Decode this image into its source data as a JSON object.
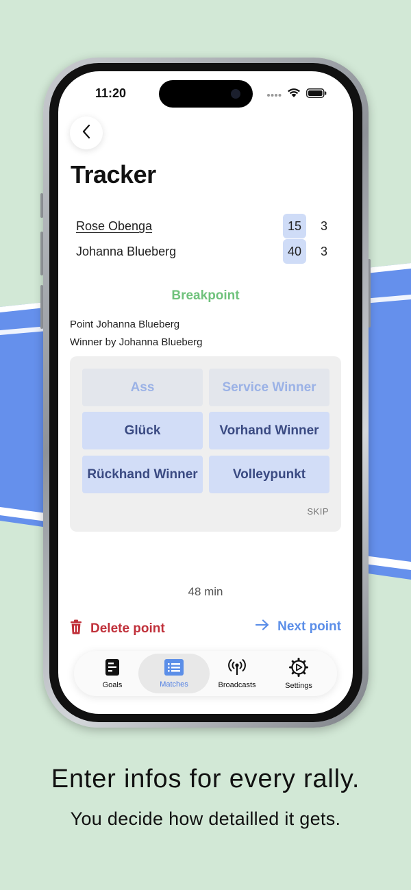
{
  "status_bar": {
    "time": "11:20"
  },
  "page": {
    "title": "Tracker"
  },
  "players": [
    {
      "name": "Rose Obenga",
      "points": "15",
      "games": "3",
      "serving": true
    },
    {
      "name": "Johanna Blueberg",
      "points": "40",
      "games": "3",
      "serving": false
    }
  ],
  "situation": "Breakpoint",
  "point_info": {
    "point_line": "Point Johanna Blueberg",
    "winner_line": "Winner by Johanna Blueberg"
  },
  "options": {
    "ace": "Ass",
    "service_winner": "Service Winner",
    "luck": "Glück",
    "forehand_winner": "Vorhand Winner",
    "backhand_winner": "Rückhand Winner",
    "volley": "Volleypunkt",
    "skip": "SKIP"
  },
  "duration": "48 min",
  "actions": {
    "delete": "Delete point",
    "next": "Next point"
  },
  "tabs": [
    {
      "label": "Goals",
      "icon": "goals-icon",
      "active": false
    },
    {
      "label": "Matches",
      "icon": "matches-icon",
      "active": true
    },
    {
      "label": "Broadcasts",
      "icon": "broadcast-icon",
      "active": false
    },
    {
      "label": "Settings",
      "icon": "settings-icon",
      "active": false
    }
  ],
  "colors": {
    "background": "#d2e8d6",
    "court_blue": "#6590ec",
    "breakpoint_green": "#6fc27c",
    "delete_red": "#c0303a",
    "next_blue": "#5b8ee8",
    "score_highlight": "#cfdcf7"
  },
  "caption": {
    "main": "Enter infos for every rally.",
    "sub": "You decide how detailled it gets."
  }
}
